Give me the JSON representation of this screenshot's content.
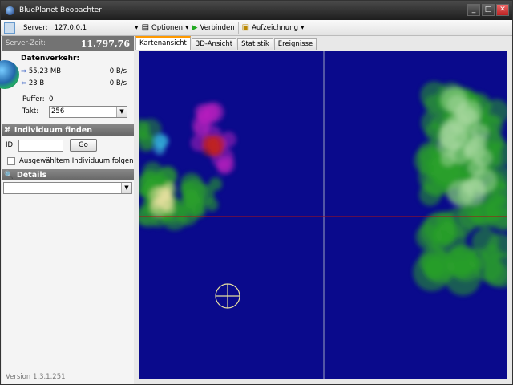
{
  "window": {
    "title": "BluePlanet Beobachter",
    "min": "_",
    "max": "□",
    "close": "✕"
  },
  "toolbar": {
    "server_label": "Server:",
    "server_value": "127.0.0.1",
    "optionen": "Optionen",
    "verbinden": "Verbinden",
    "aufzeichnung": "Aufzeichnung"
  },
  "status": {
    "server_zeit_label": "Server-Zeit:",
    "server_zeit_value": "11.797,76",
    "traffic_title": "Datenverkehr:",
    "in_total": "55,23 MB",
    "in_rate": "0 B/s",
    "out_total": "23 B",
    "out_rate": "0 B/s",
    "puffer_label": "Puffer:",
    "puffer_value": "0",
    "takt_label": "Takt:",
    "takt_value": "256"
  },
  "find": {
    "title": "Individuum finden",
    "id_label": "ID:",
    "id_value": "",
    "go": "Go",
    "follow_label": "Ausgewähltem Individuum folgen",
    "follow_checked": false
  },
  "details": {
    "title": "Details",
    "value": ""
  },
  "tabs": [
    {
      "label": "Kartenansicht",
      "active": true
    },
    {
      "label": "3D-Ansicht"
    },
    {
      "label": "Statistik"
    },
    {
      "label": "Ereignisse"
    }
  ],
  "map": {
    "background": "#0a0a8c",
    "crosshair_h_color": "#b01010",
    "crosshair_v_color": "#9aa0c0"
  },
  "version": "Version 1.3.1.251"
}
